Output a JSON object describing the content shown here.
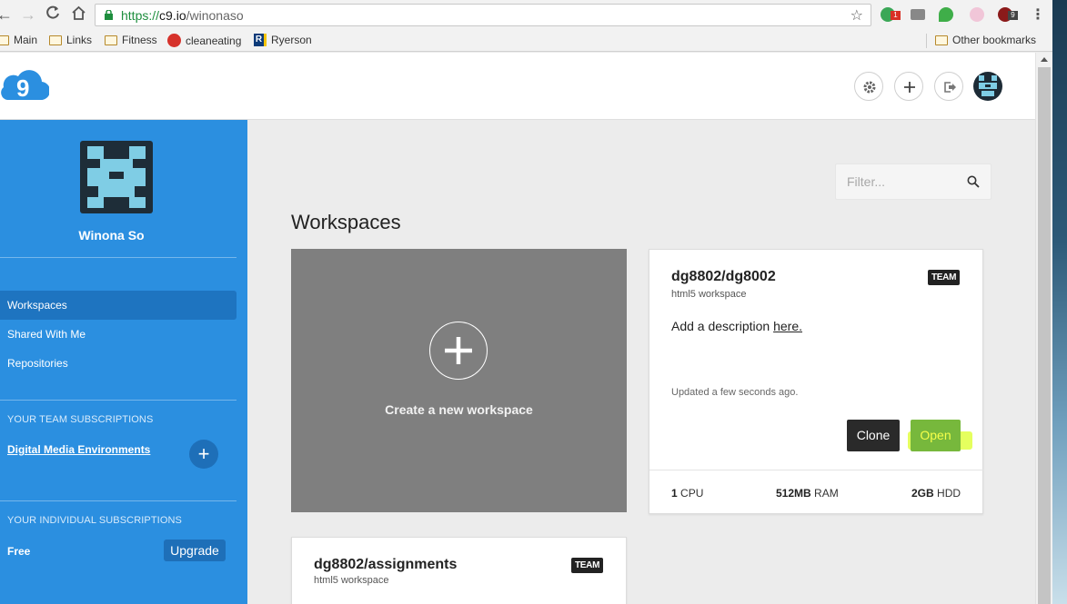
{
  "browser": {
    "url_scheme": "https://",
    "url_host": "c9.io",
    "url_path": "/winonaso",
    "ext_badges": [
      "1",
      "9"
    ],
    "bookmarks": [
      {
        "label": "Main",
        "icon": "folder-icon"
      },
      {
        "label": "Links",
        "icon": "folder-icon"
      },
      {
        "label": "Fitness",
        "icon": "folder-icon"
      },
      {
        "label": "cleaneating",
        "icon": "cleaneating-favicon"
      },
      {
        "label": "Ryerson",
        "icon": "ryerson-favicon"
      }
    ],
    "other_bookmarks": "Other bookmarks"
  },
  "sidebar": {
    "user_name": "Winona So",
    "nav": [
      {
        "label": "Workspaces",
        "active": true
      },
      {
        "label": "Shared With Me",
        "active": false
      },
      {
        "label": "Repositories",
        "active": false
      }
    ],
    "team_heading": "YOUR TEAM SUBSCRIPTIONS",
    "team_name": "Digital Media Environments",
    "add_team_label": "+",
    "individual_heading": "YOUR INDIVIDUAL SUBSCRIPTIONS",
    "plan": "Free",
    "upgrade_label": "Upgrade"
  },
  "main": {
    "filter_placeholder": "Filter...",
    "title": "Workspaces",
    "create_label": "Create a new workspace",
    "workspaces": [
      {
        "name": "dg8802/dg8002",
        "type": "html5 workspace",
        "badge": "TEAM",
        "desc_prefix": "Add a description ",
        "desc_link": "here.",
        "updated": "Updated a few seconds ago.",
        "clone_label": "Clone",
        "open_label": "Open",
        "cpu_value": "1",
        "cpu_unit": "CPU",
        "ram_value": "512MB",
        "ram_unit": "RAM",
        "hdd_value": "2GB",
        "hdd_unit": "HDD"
      },
      {
        "name": "dg8802/assignments",
        "type": "html5 workspace",
        "badge": "TEAM"
      }
    ]
  },
  "colors": {
    "sidebar": "#2b8fe0",
    "sidebar_active": "#1e74c0",
    "create_card": "#7f7f7f",
    "open_button": "#77b83c",
    "highlight": "#dcff28"
  }
}
